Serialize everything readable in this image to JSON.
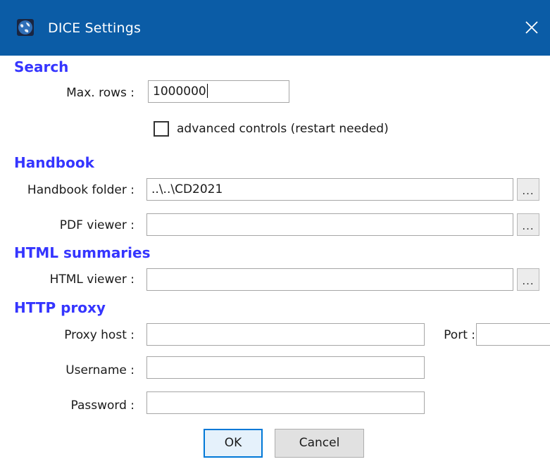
{
  "window": {
    "title": "DICE Settings",
    "title_bar_color": "#0b5ca6",
    "icon": "globe-app-icon",
    "close_icon": "close-icon"
  },
  "sections": {
    "search": "Search",
    "handbook": "Handbook",
    "html_summaries": "HTML summaries",
    "http_proxy": "HTTP proxy"
  },
  "section_color": "#3535ff",
  "search": {
    "max_rows_label": "Max. rows :",
    "max_rows_value": "1000000",
    "advanced_controls_label": "advanced controls (restart needed)",
    "advanced_controls_checked": false
  },
  "handbook": {
    "folder_label": "Handbook folder :",
    "folder_value": "..\\..\\CD2021",
    "pdf_viewer_label": "PDF viewer :",
    "pdf_viewer_value": ""
  },
  "html_summaries": {
    "viewer_label": "HTML viewer :",
    "viewer_value": ""
  },
  "http_proxy": {
    "host_label": "Proxy host :",
    "host_value": "",
    "port_label": "Port :",
    "port_value": "",
    "username_label": "Username :",
    "username_value": "",
    "password_label": "Password :",
    "password_value": ""
  },
  "browse_label": "...",
  "buttons": {
    "ok": "OK",
    "cancel": "Cancel"
  }
}
